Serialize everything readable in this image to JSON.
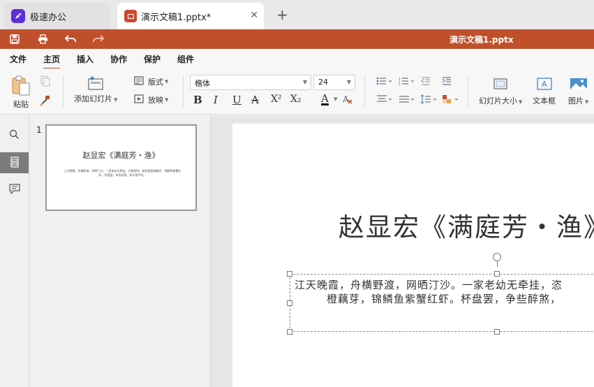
{
  "tabs": {
    "home_label": "极速办公",
    "doc_label": "演示文稿1.pptx*",
    "close_symbol": "✕",
    "new_tab_symbol": "+"
  },
  "titlebar": {
    "doc_title": "演示文稿1.pptx",
    "color": "#c0502c",
    "icons": [
      "save-icon",
      "print-icon",
      "undo-icon",
      "redo-icon"
    ]
  },
  "menu": {
    "items": [
      "文件",
      "主页",
      "插入",
      "协作",
      "保护",
      "组件"
    ],
    "active": "主页"
  },
  "ribbon": {
    "paste_label": "粘贴",
    "add_slide_label": "添加幻灯片",
    "layout_label": "版式",
    "play_label": "放映",
    "font_name": "楷体",
    "font_size": "24",
    "bold": "B",
    "italic": "I",
    "underline": "U",
    "strike": "A",
    "superscript": "X²",
    "subscript": "X₂",
    "font_color": "A",
    "slide_size_label": "幻灯片大小",
    "textbox_label": "文本框",
    "image_label": "图片"
  },
  "slides": {
    "number": "1",
    "title": "赵显宏《满庭芳・渔》",
    "body_line1": "江天晚霞，舟横野渡，网晒汀沙。一家老幼无牵挂，恣",
    "body_line2": "橙藕芽，锦鳞鱼紫蟹红虾。杯盘罢，争些醉煞，",
    "thumb_body": "江天晚霞，舟横野渡，网晒汀沙。一家老幼无牵挂，恣意喧哗。新醅泼醅橙藕芽，锦鳞鱼紫蟹红虾。杯盘罢，争些醉煞，和月宿芦花。"
  }
}
